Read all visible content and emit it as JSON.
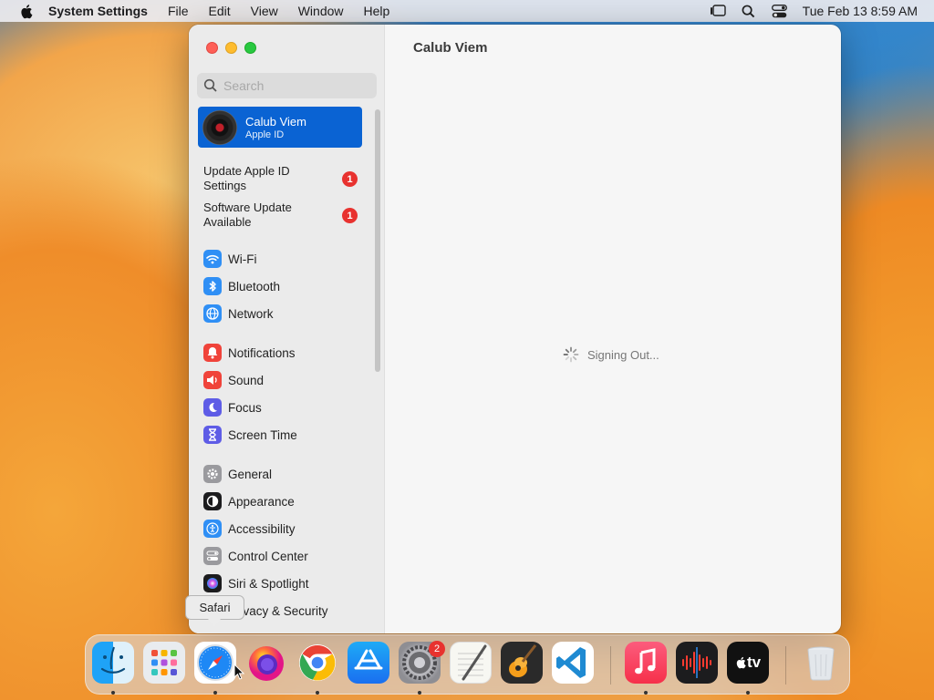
{
  "menubar": {
    "app_name": "System Settings",
    "menus": [
      "File",
      "Edit",
      "View",
      "Window",
      "Help"
    ],
    "clock": "Tue Feb 13  8:59 AM"
  },
  "window": {
    "title": "Calub Viem",
    "status_text": "Signing Out...",
    "search": {
      "placeholder": "Search"
    },
    "account": {
      "name": "Calub Viem",
      "subtitle": "Apple ID"
    },
    "notices": [
      {
        "label": "Update Apple ID Settings",
        "badge": "1"
      },
      {
        "label": "Software Update Available",
        "badge": "1"
      }
    ],
    "sidebar_groups": [
      [
        {
          "label": "Wi-Fi",
          "icon": "wifi-icon",
          "color": "#2f8ff5"
        },
        {
          "label": "Bluetooth",
          "icon": "bluetooth-icon",
          "color": "#2f8ff5"
        },
        {
          "label": "Network",
          "icon": "globe-icon",
          "color": "#2f8ff5"
        }
      ],
      [
        {
          "label": "Notifications",
          "icon": "bell-icon",
          "color": "#f0433a"
        },
        {
          "label": "Sound",
          "icon": "speaker-icon",
          "color": "#f0433a"
        },
        {
          "label": "Focus",
          "icon": "moon-icon",
          "color": "#5e5ce6"
        },
        {
          "label": "Screen Time",
          "icon": "hourglass-icon",
          "color": "#5e5ce6"
        }
      ],
      [
        {
          "label": "General",
          "icon": "gear-icon",
          "color": "#9a9a9e"
        },
        {
          "label": "Appearance",
          "icon": "appearance-icon",
          "color": "#1c1c1e"
        },
        {
          "label": "Accessibility",
          "icon": "accessibility-icon",
          "color": "#2f8ff5"
        },
        {
          "label": "Control Center",
          "icon": "control-center-icon",
          "color": "#9a9a9e"
        },
        {
          "label": "Siri & Spotlight",
          "icon": "siri-icon",
          "color": "#1c1c1e"
        },
        {
          "label": "Privacy & Security",
          "icon": "hand-icon",
          "color": "#2f8ff5"
        }
      ]
    ]
  },
  "tooltip": {
    "text": "Safari"
  },
  "dock": {
    "apps": [
      {
        "name": "finder-icon",
        "color": "#1e9bf0",
        "running": true
      },
      {
        "name": "launchpad-icon",
        "color": "#e9ecef",
        "running": false
      },
      {
        "name": "safari-icon",
        "color": "#ffffff",
        "running": true
      },
      {
        "name": "firefox-icon",
        "color": "#3b2a8c",
        "running": false
      },
      {
        "name": "chrome-icon",
        "color": "#ffffff",
        "running": true
      },
      {
        "name": "app-store-icon",
        "color": "#1b8cf2",
        "running": false
      },
      {
        "name": "system-settings-icon",
        "color": "#8e8e93",
        "running": true,
        "badge": "2"
      },
      {
        "name": "textedit-icon",
        "color": "#f7f7f2",
        "running": false
      },
      {
        "name": "garageband-icon",
        "color": "#2a2a2a",
        "running": false
      },
      {
        "name": "vscode-icon",
        "color": "#ffffff",
        "running": false
      },
      {
        "name": "music-icon",
        "color": "#fa3c50",
        "running": true
      },
      {
        "name": "voice-memos-icon",
        "color": "#1c1c1e",
        "running": false
      },
      {
        "name": "apple-tv-icon",
        "color": "#111111",
        "running": true
      },
      {
        "name": "trash-icon",
        "color": "#dfe3e8",
        "running": false
      }
    ],
    "tv_label": "tv"
  }
}
